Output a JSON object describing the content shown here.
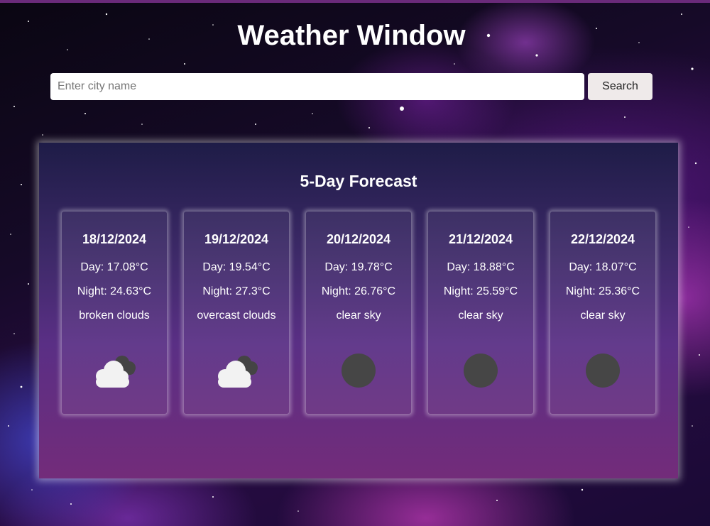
{
  "app": {
    "title": "Weather Window"
  },
  "search": {
    "placeholder": "Enter city name",
    "value": "",
    "button_label": "Search"
  },
  "forecast": {
    "title": "5-Day Forecast",
    "days": [
      {
        "date": "18/12/2024",
        "day": "Day: 17.08°C",
        "night": "Night: 24.63°C",
        "description": "broken clouds",
        "icon": "broken-clouds-icon"
      },
      {
        "date": "19/12/2024",
        "day": "Day: 19.54°C",
        "night": "Night: 27.3°C",
        "description": "overcast clouds",
        "icon": "overcast-clouds-icon"
      },
      {
        "date": "20/12/2024",
        "day": "Day: 19.78°C",
        "night": "Night: 26.76°C",
        "description": "clear sky",
        "icon": "clear-sky-icon"
      },
      {
        "date": "21/12/2024",
        "day": "Day: 18.88°C",
        "night": "Night: 25.59°C",
        "description": "clear sky",
        "icon": "clear-sky-icon"
      },
      {
        "date": "22/12/2024",
        "day": "Day: 18.07°C",
        "night": "Night: 25.36°C",
        "description": "clear sky",
        "icon": "clear-sky-icon"
      }
    ]
  },
  "colors": {
    "panel_top": "#1e1c47",
    "panel_bottom": "#732c7a",
    "cloud_white": "#f2f2f2",
    "cloud_dark": "#444444",
    "sun_disc": "#464646"
  }
}
